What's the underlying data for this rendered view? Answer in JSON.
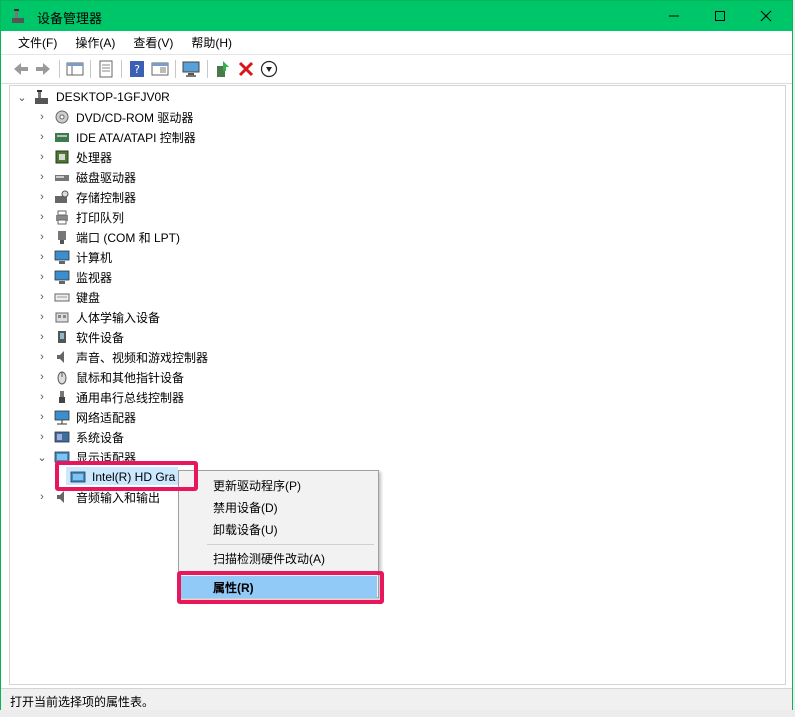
{
  "window": {
    "title": "设备管理器",
    "minimize_icon": "minimize-icon",
    "maximize_icon": "maximize-icon",
    "close_icon": "close-icon"
  },
  "menu": [
    "文件(F)",
    "操作(A)",
    "查看(V)",
    "帮助(H)"
  ],
  "toolbar": [
    "back-icon",
    "forward-icon",
    "console-tree-icon",
    "properties-icon",
    "help-icon",
    "view-icon",
    "scan-hardware-icon",
    "update-driver-icon",
    "uninstall-icon",
    "disable-icon"
  ],
  "tree": {
    "root": "DESKTOP-1GFJV0R",
    "categories": [
      {
        "label": "DVD/CD-ROM 驱动器",
        "icon": "dvd-drive-icon"
      },
      {
        "label": "IDE ATA/ATAPI 控制器",
        "icon": "ide-controller-icon"
      },
      {
        "label": "处理器",
        "icon": "processor-icon"
      },
      {
        "label": "磁盘驱动器",
        "icon": "disk-drive-icon"
      },
      {
        "label": "存储控制器",
        "icon": "storage-controller-icon"
      },
      {
        "label": "打印队列",
        "icon": "printer-icon"
      },
      {
        "label": "端口 (COM 和 LPT)",
        "icon": "port-icon"
      },
      {
        "label": "计算机",
        "icon": "computer-icon"
      },
      {
        "label": "监视器",
        "icon": "monitor-icon"
      },
      {
        "label": "键盘",
        "icon": "keyboard-icon"
      },
      {
        "label": "人体学输入设备",
        "icon": "hid-icon"
      },
      {
        "label": "软件设备",
        "icon": "software-device-icon"
      },
      {
        "label": "声音、视频和游戏控制器",
        "icon": "speaker-icon"
      },
      {
        "label": "鼠标和其他指针设备",
        "icon": "mouse-icon"
      },
      {
        "label": "通用串行总线控制器",
        "icon": "usb-icon"
      },
      {
        "label": "网络适配器",
        "icon": "network-icon"
      },
      {
        "label": "系统设备",
        "icon": "system-device-icon"
      },
      {
        "label": "显示适配器",
        "icon": "display-adapter-icon"
      }
    ],
    "child": "Intel(R) HD Gra",
    "last_category": "音频输入和输出"
  },
  "context_menu": {
    "items": [
      "更新驱动程序(P)",
      "禁用设备(D)",
      "卸载设备(U)"
    ],
    "scan": "扫描检测硬件改动(A)",
    "properties": "属性(R)"
  },
  "status": "打开当前选择项的属性表。",
  "colors": {
    "titlebar": "#00c66a",
    "highlight": "#e8175d",
    "menu_hover": "#91c9f7"
  }
}
